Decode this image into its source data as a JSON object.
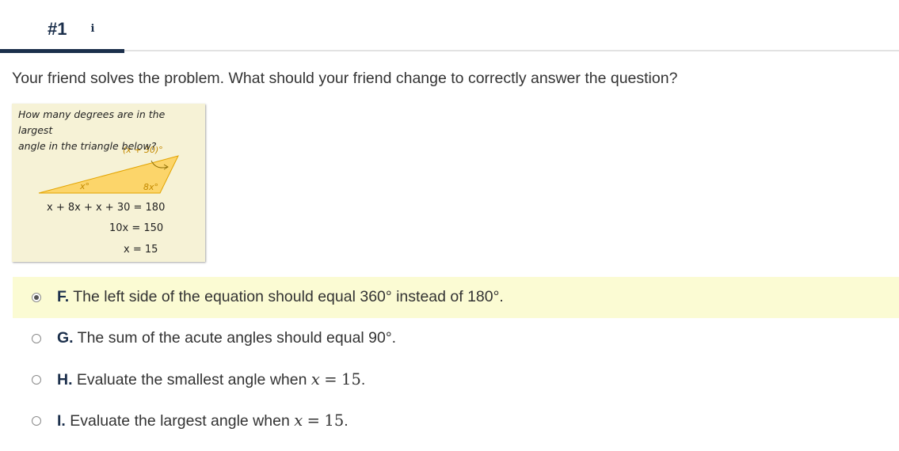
{
  "header": {
    "question_number": "#1",
    "info_icon_glyph": "i"
  },
  "prompt": "Your friend solves the problem. What should your friend change to correctly answer the question?",
  "figure": {
    "question_line1": "How many degrees are in the largest",
    "question_line2": "angle in the triangle below?",
    "angle_top": "(x + 30)°",
    "angle_left": "x°",
    "angle_right": "8x°",
    "equation1": "x + 8x + x + 30 = 180",
    "equation2": "10x = 150",
    "equation3": "x = 15",
    "triangle_fill": "#fcd56a",
    "triangle_stroke": "#e3a400"
  },
  "options": [
    {
      "letter": "F.",
      "text_before": "The left side of the equation should equal 360° instead of 180°.",
      "var": "",
      "eq": "",
      "num": "",
      "text_after": "",
      "selected": true
    },
    {
      "letter": "G.",
      "text_before": "The sum of the acute angles should equal 90°.",
      "var": "",
      "eq": "",
      "num": "",
      "text_after": "",
      "selected": false
    },
    {
      "letter": "H.",
      "text_before": "Evaluate the smallest angle when",
      "var": "x",
      "eq": "=",
      "num": "15",
      "text_after": ".",
      "selected": false
    },
    {
      "letter": "I.",
      "text_before": "Evaluate the largest angle when",
      "var": "x",
      "eq": "=",
      "num": "15",
      "text_after": ".",
      "selected": false
    }
  ],
  "colors": {
    "accent": "#1b2f4b",
    "selected_row": "#fbfbd3",
    "figure_bg": "#f6f2d6"
  }
}
